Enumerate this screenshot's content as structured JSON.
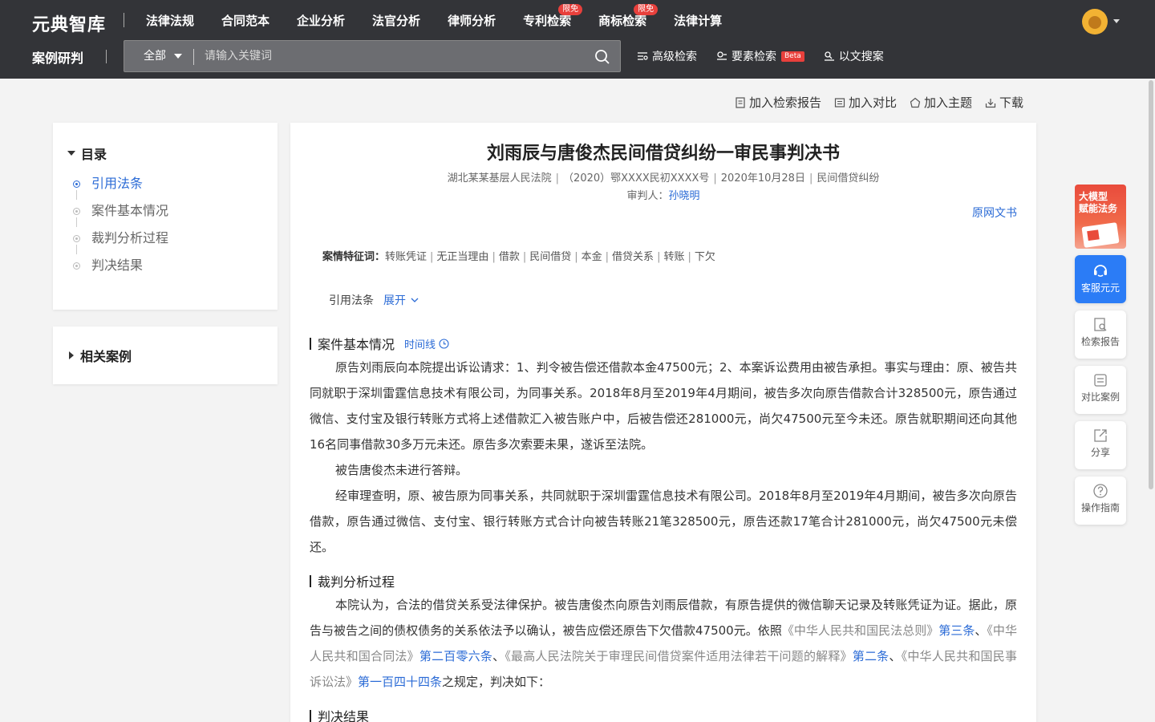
{
  "header": {
    "logo": "元典智库",
    "nav": [
      {
        "label": "法律法规",
        "badge": ""
      },
      {
        "label": "合同范本",
        "badge": ""
      },
      {
        "label": "企业分析",
        "badge": ""
      },
      {
        "label": "法官分析",
        "badge": ""
      },
      {
        "label": "律师分析",
        "badge": ""
      },
      {
        "label": "专利检索",
        "badge": "限免"
      },
      {
        "label": "商标检索",
        "badge": "限免"
      },
      {
        "label": "法律计算",
        "badge": ""
      }
    ]
  },
  "subbar": {
    "section_title": "案例研判",
    "search_scope": "全部",
    "search_placeholder": "请输入关键词",
    "links": {
      "advanced": "高级检索",
      "element": "要素检索",
      "element_badge": "Beta",
      "by_text": "以文搜案"
    }
  },
  "actions": {
    "add_report": "加入检索报告",
    "add_compare": "加入对比",
    "add_topic": "加入主题",
    "download": "下载"
  },
  "toc": {
    "title": "目录",
    "items": [
      "引用法条",
      "案件基本情况",
      "裁判分析过程",
      "判决结果"
    ]
  },
  "related": {
    "title": "相关案例"
  },
  "document": {
    "title": "刘雨辰与唐俊杰民间借贷纠纷一审民事判决书",
    "meta": {
      "court": "湖北某某基层人民法院",
      "case_no": "（2020）鄂XXXX民初XXXX号",
      "date": "2020年10月28日",
      "cause": "民间借贷纠纷"
    },
    "judge_label": "审判人：",
    "judge_name": "孙晓明",
    "orig_link": "原网文书",
    "features_label": "案情特征词：",
    "features": [
      "转账凭证",
      "无正当理由",
      "借款",
      "民间借贷",
      "本金",
      "借贷关系",
      "转账",
      "下欠"
    ],
    "cite_label": "引用法条",
    "cite_expand": "展开",
    "sections": {
      "basic": {
        "title": "案件基本情况",
        "timeline": "时间线",
        "p1": "原告刘雨辰向本院提出诉讼请求：1、判令被告偿还借款本金47500元；2、本案诉讼费用由被告承担。事实与理由：原、被告共同就职于深圳雷霆信息技术有限公司，为同事关系。2018年8月至2019年4月期间，被告多次向原告借款合计328500元，原告通过微信、支付宝及银行转账方式将上述借款汇入被告账户中，后被告偿还281000元，尚欠47500元至今未还。原告就职期间还向其他16名同事借款30多万元未还。原告多次索要未果，遂诉至法院。",
        "p2": "被告唐俊杰未进行答辩。",
        "p3": "经审理查明，原、被告原为同事关系，共同就职于深圳雷霆信息技术有限公司。2018年8月至2019年4月期间，被告多次向原告借款，原告通过微信、支付宝、银行转账方式合计向被告转账21笔328500元，原告还款17笔合计281000元，尚欠47500元未偿还。"
      },
      "analysis": {
        "title": "裁判分析过程",
        "p1_a": "本院认为，合法的借贷关系受法律保护。被告唐俊杰向原告刘雨辰借款，有原告提供的微信聊天记录及转账凭证为证。据此，原告与被告之间的债权债务的关系依法予以确认，被告应偿还原告下欠借款47500元。依照",
        "law1": "《中华人民共和国民法总则》",
        "art1": "第三条",
        "sep1": "、",
        "law2": "《中华人民共和国合同法》",
        "art2": "第二百零六条",
        "sep2": "、",
        "law3": "《最高人民法院关于审理民间借贷案件适用法律若干问题的解释》",
        "art3": "第二条",
        "sep3": "、",
        "law4": "《中华人民共和国民事诉讼法》",
        "art4": "第一百四十四条",
        "p1_end": "之规定，判决如下："
      },
      "result": {
        "title": "判决结果"
      }
    }
  },
  "float": {
    "ad_text": "大模型\n赋能法务",
    "service": "客服元元",
    "report": "检索报告",
    "compare": "对比案例",
    "share": "分享",
    "guide": "操作指南"
  },
  "colors": {
    "header_bg": "#333438",
    "accent": "#2b6bd6",
    "badge": "#e8403c"
  }
}
